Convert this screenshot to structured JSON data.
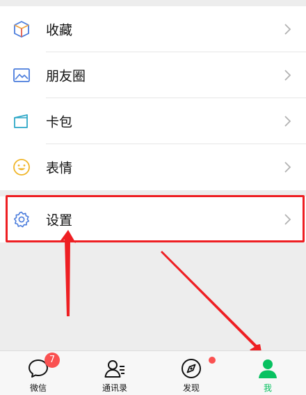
{
  "menu": {
    "items": [
      {
        "label": "收藏",
        "icon": "favorites-cube-icon"
      },
      {
        "label": "朋友圈",
        "icon": "moments-picture-icon"
      },
      {
        "label": "卡包",
        "icon": "card-wallet-icon"
      },
      {
        "label": "表情",
        "icon": "sticker-smiley-icon"
      }
    ],
    "settings": {
      "label": "设置",
      "icon": "gear-icon"
    }
  },
  "tabbar": {
    "tabs": [
      {
        "label": "微信",
        "icon": "chat-bubble-icon",
        "badge": "7"
      },
      {
        "label": "通讯录",
        "icon": "contacts-icon"
      },
      {
        "label": "发现",
        "icon": "compass-icon"
      },
      {
        "label": "我",
        "icon": "person-icon",
        "active": true
      }
    ]
  },
  "colors": {
    "accent": "#07c160",
    "badge": "#fa5151",
    "annotation": "#ee1f23"
  }
}
